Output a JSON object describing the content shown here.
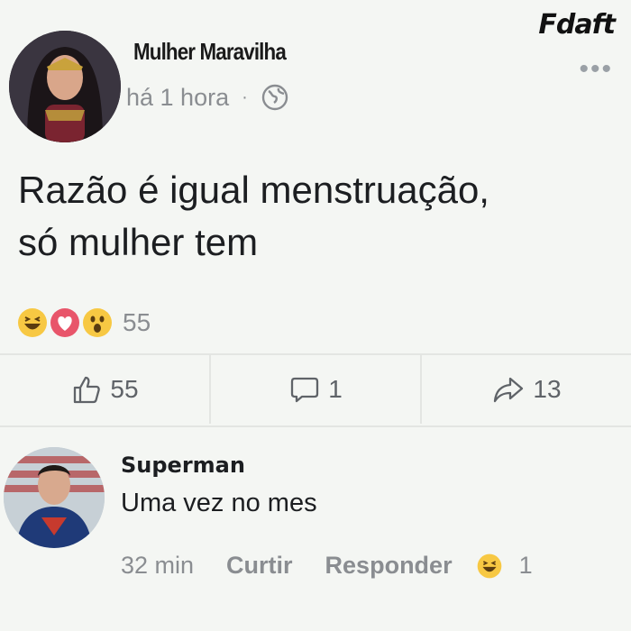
{
  "watermark": "Fdaft",
  "post": {
    "author": "Mulher Maravilha",
    "time": "há 1 hora",
    "separator": "·",
    "privacy_icon": "globe-icon",
    "more_label": "•••",
    "text_line1": "Razão é igual menstruação,",
    "text_line2": "só mulher tem",
    "reactions": [
      "haha",
      "love",
      "wow"
    ],
    "reaction_count": "55"
  },
  "actions": {
    "like_count": "55",
    "comment_count": "1",
    "share_count": "13"
  },
  "comment": {
    "author": "Superman",
    "text": "Uma vez no mes",
    "time": "32 min",
    "like_label": "Curtir",
    "reply_label": "Responder",
    "reaction": "haha",
    "reaction_count": "1"
  },
  "colors": {
    "background": "#f4f6f3",
    "muted": "#8a8d91",
    "haha": "#f7c843",
    "love": "#e8556a"
  }
}
